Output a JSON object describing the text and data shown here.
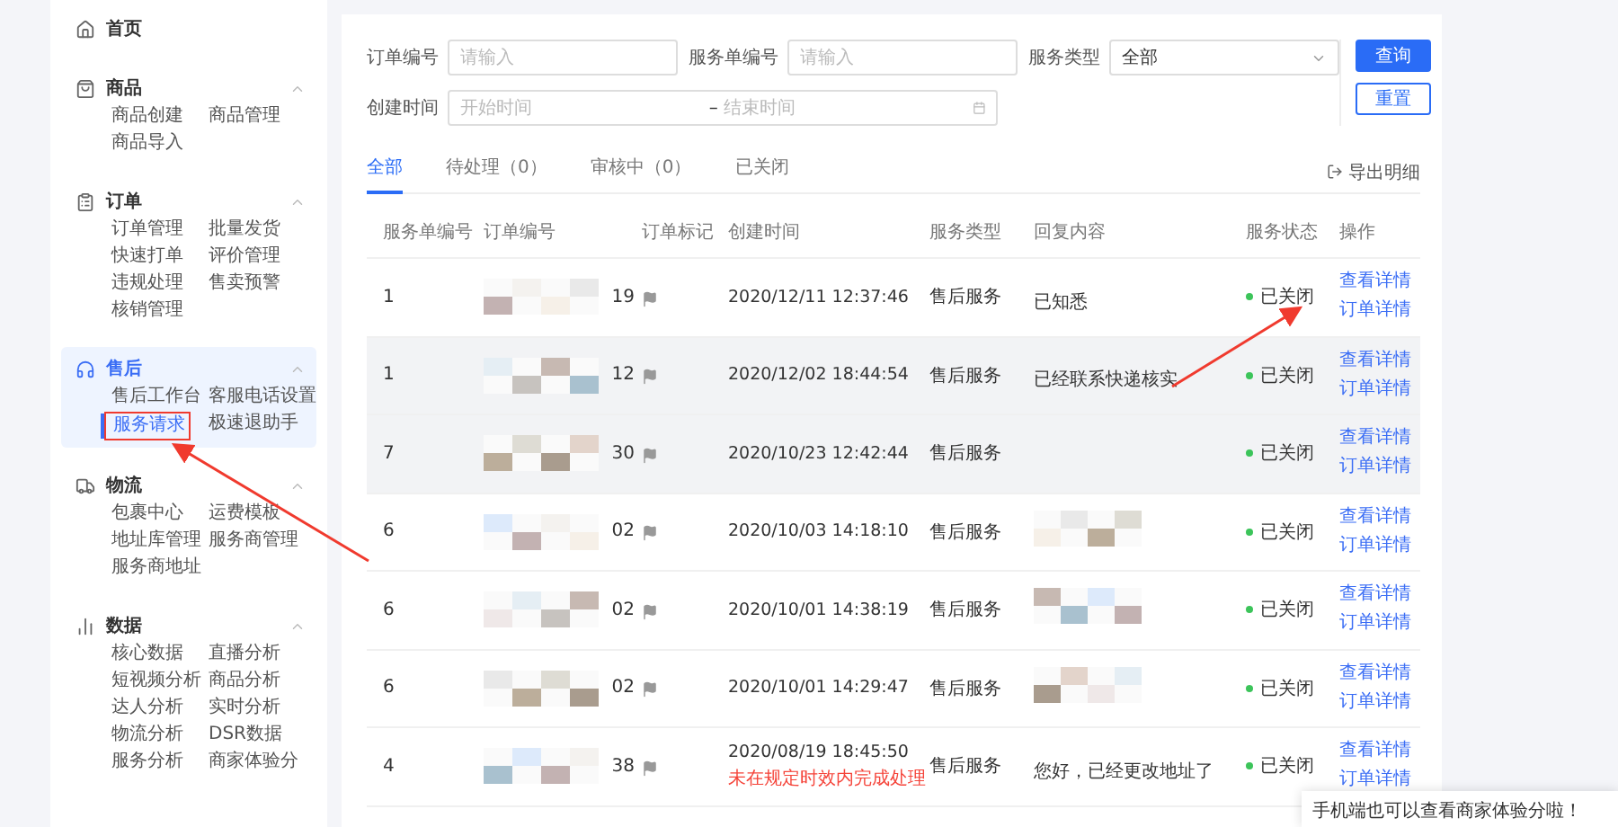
{
  "sidebar": {
    "home": {
      "label": "首页",
      "selected": false
    },
    "groups": [
      {
        "label": "商品",
        "expanded": true,
        "selected": false,
        "items": [
          {
            "label": "商品创建",
            "selected": false
          },
          {
            "label": "商品管理",
            "selected": false
          },
          {
            "label": "商品导入",
            "selected": false
          }
        ]
      },
      {
        "label": "订单",
        "expanded": true,
        "selected": false,
        "items": [
          {
            "label": "订单管理",
            "selected": false
          },
          {
            "label": "批量发货",
            "selected": false
          },
          {
            "label": "快速打单",
            "selected": false
          },
          {
            "label": "评价管理",
            "selected": false
          },
          {
            "label": "违规处理",
            "selected": false
          },
          {
            "label": "售卖预警",
            "selected": false
          },
          {
            "label": "核销管理",
            "selected": false
          }
        ]
      },
      {
        "label": "售后",
        "expanded": true,
        "selected": true,
        "items": [
          {
            "label": "售后工作台",
            "selected": false
          },
          {
            "label": "客服电话设置",
            "selected": false
          },
          {
            "label": "服务请求",
            "selected": true
          },
          {
            "label": "极速退助手",
            "selected": false
          }
        ]
      },
      {
        "label": "物流",
        "expanded": true,
        "selected": false,
        "items": [
          {
            "label": "包裹中心",
            "selected": false
          },
          {
            "label": "运费模板",
            "selected": false
          },
          {
            "label": "地址库管理",
            "selected": false
          },
          {
            "label": "服务商管理",
            "selected": false
          },
          {
            "label": "服务商地址",
            "selected": false
          }
        ]
      },
      {
        "label": "数据",
        "expanded": true,
        "selected": false,
        "items": [
          {
            "label": "核心数据",
            "selected": false
          },
          {
            "label": "直播分析",
            "selected": false
          },
          {
            "label": "短视频分析",
            "selected": false
          },
          {
            "label": "商品分析",
            "selected": false
          },
          {
            "label": "达人分析",
            "selected": false
          },
          {
            "label": "实时分析",
            "selected": false
          },
          {
            "label": "物流分析",
            "selected": false
          },
          {
            "label": "DSR数据",
            "selected": false
          },
          {
            "label": "服务分析",
            "selected": false
          },
          {
            "label": "商家体验分",
            "selected": false
          }
        ]
      }
    ]
  },
  "filters": {
    "order_no": {
      "label": "订单编号",
      "placeholder": "请输入"
    },
    "service_no": {
      "label": "服务单编号",
      "placeholder": "请输入"
    },
    "service_type": {
      "label": "服务类型",
      "value": "全部"
    },
    "created": {
      "label": "创建时间",
      "start_placeholder": "开始时间",
      "separator": "–",
      "end_placeholder": "结束时间"
    },
    "buttons": {
      "search": "查询",
      "reset": "重置"
    }
  },
  "tabs": [
    {
      "label": "全部",
      "selected": true
    },
    {
      "label": "待处理（0）",
      "selected": false
    },
    {
      "label": "审核中（0）",
      "selected": false
    },
    {
      "label": "已关闭",
      "selected": false
    }
  ],
  "export": "导出明细",
  "table": {
    "columns": [
      "服务单编号",
      "订单编号",
      "订单标记",
      "创建时间",
      "服务类型",
      "回复内容",
      "服务状态",
      "操作"
    ],
    "rows": [
      {
        "service_no": "1",
        "order_no": "19",
        "created": "2020/12/11 12:37:46",
        "type": "售后服务",
        "reply": "已知悉",
        "reply_hidden": false,
        "highlighted": false,
        "status": {
          "text": "已关闭",
          "kind": "closed"
        },
        "actions": [
          "查看详情",
          "订单详情"
        ]
      },
      {
        "service_no": "1",
        "order_no": "12",
        "created": "2020/12/02 18:44:54",
        "type": "售后服务",
        "reply": "已经联系快递核实",
        "reply_hidden": false,
        "highlighted": true,
        "status": {
          "text": "已关闭",
          "kind": "closed"
        },
        "actions": [
          "查看详情",
          "订单详情"
        ]
      },
      {
        "service_no": "7",
        "order_no": "30",
        "created": "2020/10/23 12:42:44",
        "type": "售后服务",
        "reply_hidden": false,
        "highlighted": true,
        "status": {
          "text": "已关闭",
          "kind": "closed"
        },
        "actions": [
          "查看详情",
          "订单详情"
        ]
      },
      {
        "service_no": "6",
        "order_no": "02",
        "created": "2020/10/03 14:18:10",
        "type": "售后服务",
        "reply_hidden": true,
        "highlighted": false,
        "status": {
          "text": "已关闭",
          "kind": "closed"
        },
        "actions": [
          "查看详情",
          "订单详情"
        ]
      },
      {
        "service_no": "6",
        "order_no": "02",
        "created": "2020/10/01 14:38:19",
        "type": "售后服务",
        "reply_hidden": true,
        "highlighted": false,
        "status": {
          "text": "已关闭",
          "kind": "closed"
        },
        "actions": [
          "查看详情",
          "订单详情"
        ]
      },
      {
        "service_no": "6",
        "order_no": "02",
        "created": "2020/10/01 14:29:47",
        "type": "售后服务",
        "reply_hidden": true,
        "highlighted": false,
        "status": {
          "text": "已关闭",
          "kind": "closed"
        },
        "actions": [
          "查看详情",
          "订单详情"
        ]
      },
      {
        "service_no": "4",
        "order_no": "38",
        "created": "2020/08/19 18:45:50",
        "warning": "未在规定时效内完成处理",
        "type": "售后服务",
        "reply": "您好，已经更改地址了",
        "reply_hidden": false,
        "highlighted": false,
        "status": {
          "text": "已关闭",
          "kind": "closed"
        },
        "actions": [
          "查看详情",
          "订单详情"
        ]
      }
    ]
  },
  "toast": "手机端也可以查看商家体验分啦！"
}
